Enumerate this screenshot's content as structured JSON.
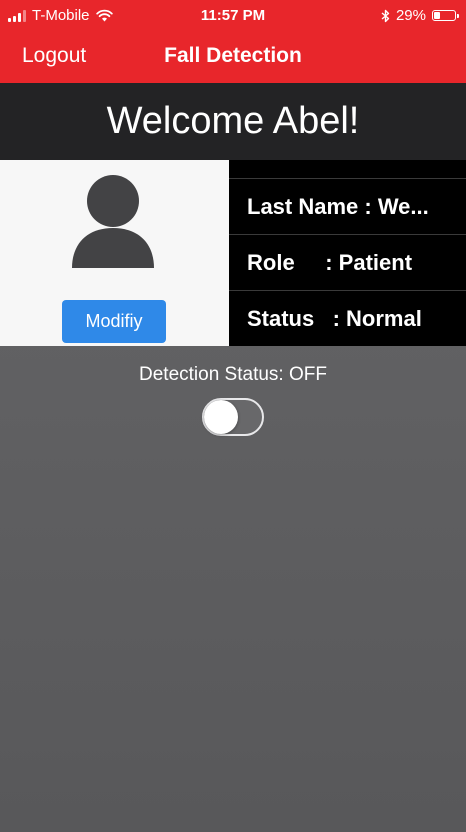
{
  "status_bar": {
    "carrier": "T-Mobile",
    "time": "11:57 PM",
    "battery_percent": "29%",
    "battery_level": 0.29,
    "icons": [
      "signal-icon",
      "wifi-icon",
      "bluetooth-icon",
      "battery-icon"
    ]
  },
  "navbar": {
    "logout_label": "Logout",
    "title": "Fall Detection"
  },
  "welcome": {
    "text": "Welcome Abel!"
  },
  "profile": {
    "avatar_icon": "user-avatar-icon",
    "modify_label": "Modifiy",
    "fields": [
      {
        "text": "Last Name : We..."
      },
      {
        "text": "Role     : Patient"
      },
      {
        "text": "Status   : Normal"
      }
    ]
  },
  "detection": {
    "label": "Detection Status: OFF",
    "enabled": false
  },
  "colors": {
    "nav_red": "#e8262b",
    "banner": "#232325",
    "button_blue": "#2f89e8",
    "background": "#616163"
  }
}
